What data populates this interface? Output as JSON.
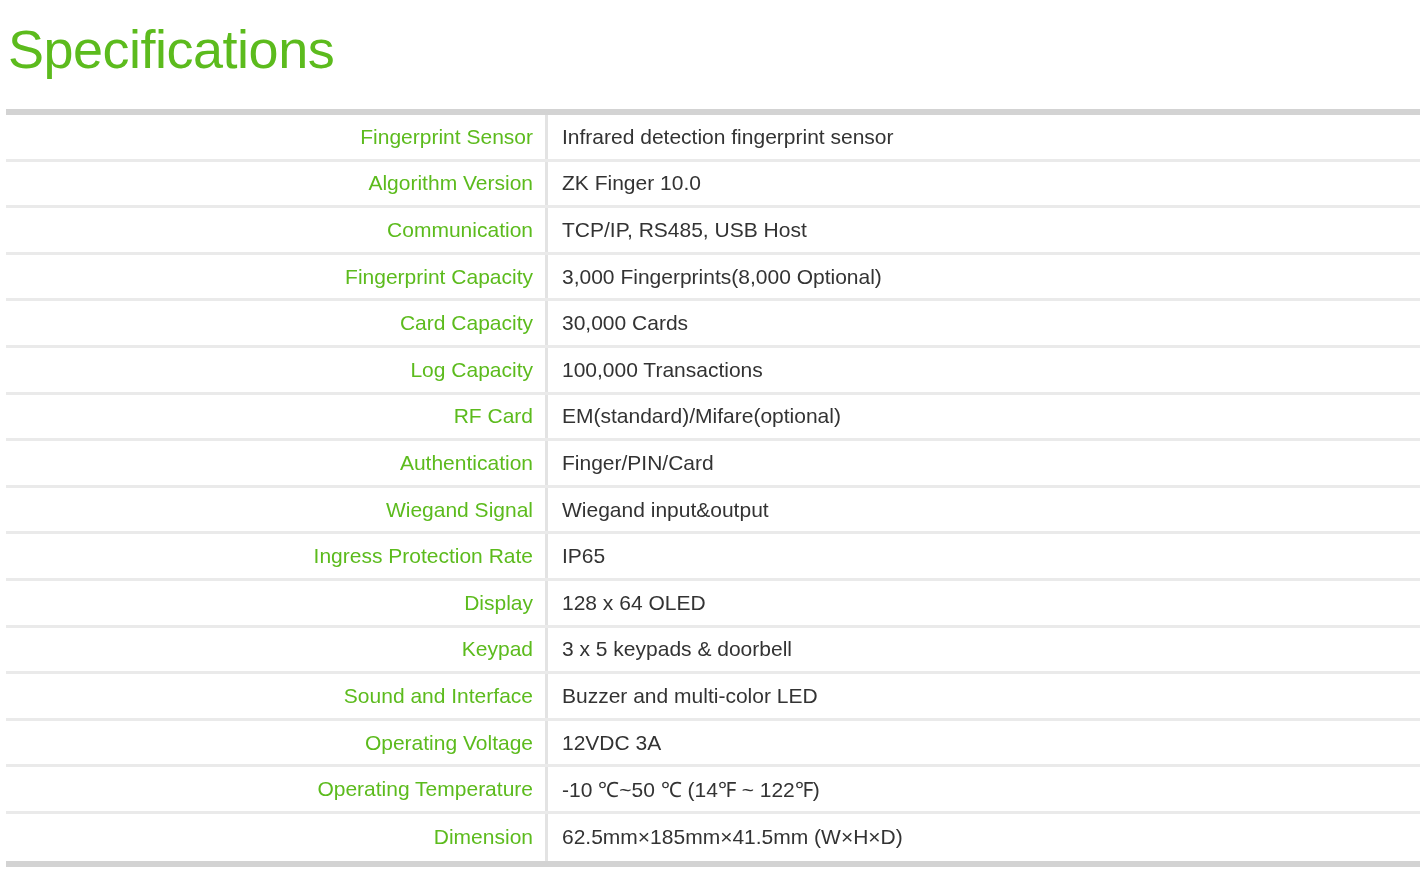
{
  "title": "Specifications",
  "rows": [
    {
      "label": "Fingerprint Sensor",
      "value": "Infrared detection fingerprint sensor"
    },
    {
      "label": "Algorithm Version",
      "value": "ZK Finger 10.0"
    },
    {
      "label": "Communication",
      "value": "TCP/IP, RS485, USB Host"
    },
    {
      "label": "Fingerprint Capacity",
      "value": "3,000 Fingerprints(8,000 Optional)"
    },
    {
      "label": "Card Capacity",
      "value": "30,000 Cards"
    },
    {
      "label": "Log Capacity",
      "value": "100,000 Transactions"
    },
    {
      "label": "RF Card",
      "value": "EM(standard)/Mifare(optional)"
    },
    {
      "label": "Authentication",
      "value": "Finger/PIN/Card"
    },
    {
      "label": "Wiegand Signal",
      "value": "Wiegand input&output"
    },
    {
      "label": "Ingress Protection Rate",
      "value": "IP65"
    },
    {
      "label": "Display",
      "value": "128 x 64 OLED"
    },
    {
      "label": "Keypad",
      "value": "3 x 5 keypads & doorbell"
    },
    {
      "label": "Sound and Interface",
      "value": "Buzzer and multi-color LED"
    },
    {
      "label": "Operating Voltage",
      "value": "12VDC 3A"
    },
    {
      "label": "Operating Temperature",
      "value": "-10 ℃~50 ℃ (14℉ ~ 122℉)"
    },
    {
      "label": "Dimension",
      "value": "62.5mm×185mm×41.5mm (W×H×D)"
    }
  ]
}
